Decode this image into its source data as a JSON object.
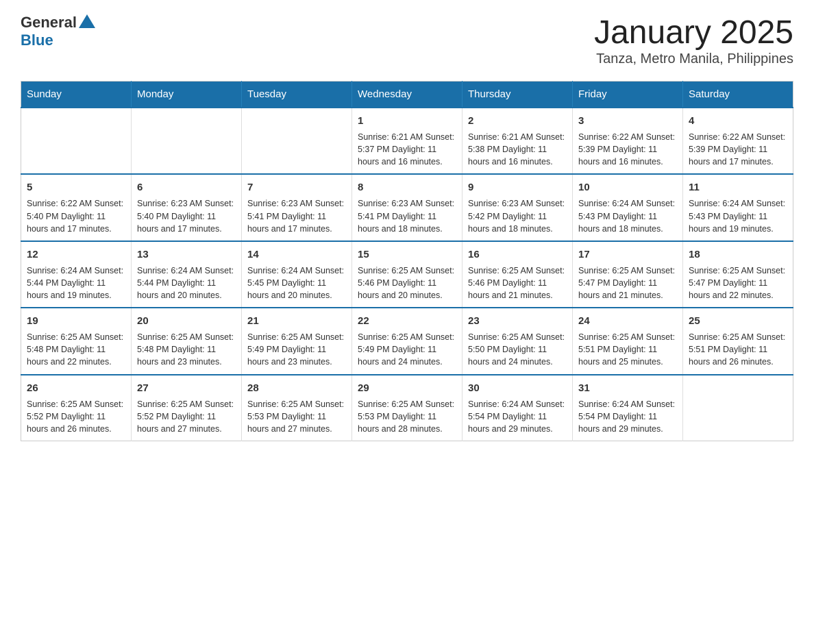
{
  "header": {
    "logo_general": "General",
    "logo_blue": "Blue",
    "title": "January 2025",
    "subtitle": "Tanza, Metro Manila, Philippines"
  },
  "weekdays": [
    "Sunday",
    "Monday",
    "Tuesday",
    "Wednesday",
    "Thursday",
    "Friday",
    "Saturday"
  ],
  "weeks": [
    [
      {
        "day": "",
        "info": ""
      },
      {
        "day": "",
        "info": ""
      },
      {
        "day": "",
        "info": ""
      },
      {
        "day": "1",
        "info": "Sunrise: 6:21 AM\nSunset: 5:37 PM\nDaylight: 11 hours and 16 minutes."
      },
      {
        "day": "2",
        "info": "Sunrise: 6:21 AM\nSunset: 5:38 PM\nDaylight: 11 hours and 16 minutes."
      },
      {
        "day": "3",
        "info": "Sunrise: 6:22 AM\nSunset: 5:39 PM\nDaylight: 11 hours and 16 minutes."
      },
      {
        "day": "4",
        "info": "Sunrise: 6:22 AM\nSunset: 5:39 PM\nDaylight: 11 hours and 17 minutes."
      }
    ],
    [
      {
        "day": "5",
        "info": "Sunrise: 6:22 AM\nSunset: 5:40 PM\nDaylight: 11 hours and 17 minutes."
      },
      {
        "day": "6",
        "info": "Sunrise: 6:23 AM\nSunset: 5:40 PM\nDaylight: 11 hours and 17 minutes."
      },
      {
        "day": "7",
        "info": "Sunrise: 6:23 AM\nSunset: 5:41 PM\nDaylight: 11 hours and 17 minutes."
      },
      {
        "day": "8",
        "info": "Sunrise: 6:23 AM\nSunset: 5:41 PM\nDaylight: 11 hours and 18 minutes."
      },
      {
        "day": "9",
        "info": "Sunrise: 6:23 AM\nSunset: 5:42 PM\nDaylight: 11 hours and 18 minutes."
      },
      {
        "day": "10",
        "info": "Sunrise: 6:24 AM\nSunset: 5:43 PM\nDaylight: 11 hours and 18 minutes."
      },
      {
        "day": "11",
        "info": "Sunrise: 6:24 AM\nSunset: 5:43 PM\nDaylight: 11 hours and 19 minutes."
      }
    ],
    [
      {
        "day": "12",
        "info": "Sunrise: 6:24 AM\nSunset: 5:44 PM\nDaylight: 11 hours and 19 minutes."
      },
      {
        "day": "13",
        "info": "Sunrise: 6:24 AM\nSunset: 5:44 PM\nDaylight: 11 hours and 20 minutes."
      },
      {
        "day": "14",
        "info": "Sunrise: 6:24 AM\nSunset: 5:45 PM\nDaylight: 11 hours and 20 minutes."
      },
      {
        "day": "15",
        "info": "Sunrise: 6:25 AM\nSunset: 5:46 PM\nDaylight: 11 hours and 20 minutes."
      },
      {
        "day": "16",
        "info": "Sunrise: 6:25 AM\nSunset: 5:46 PM\nDaylight: 11 hours and 21 minutes."
      },
      {
        "day": "17",
        "info": "Sunrise: 6:25 AM\nSunset: 5:47 PM\nDaylight: 11 hours and 21 minutes."
      },
      {
        "day": "18",
        "info": "Sunrise: 6:25 AM\nSunset: 5:47 PM\nDaylight: 11 hours and 22 minutes."
      }
    ],
    [
      {
        "day": "19",
        "info": "Sunrise: 6:25 AM\nSunset: 5:48 PM\nDaylight: 11 hours and 22 minutes."
      },
      {
        "day": "20",
        "info": "Sunrise: 6:25 AM\nSunset: 5:48 PM\nDaylight: 11 hours and 23 minutes."
      },
      {
        "day": "21",
        "info": "Sunrise: 6:25 AM\nSunset: 5:49 PM\nDaylight: 11 hours and 23 minutes."
      },
      {
        "day": "22",
        "info": "Sunrise: 6:25 AM\nSunset: 5:49 PM\nDaylight: 11 hours and 24 minutes."
      },
      {
        "day": "23",
        "info": "Sunrise: 6:25 AM\nSunset: 5:50 PM\nDaylight: 11 hours and 24 minutes."
      },
      {
        "day": "24",
        "info": "Sunrise: 6:25 AM\nSunset: 5:51 PM\nDaylight: 11 hours and 25 minutes."
      },
      {
        "day": "25",
        "info": "Sunrise: 6:25 AM\nSunset: 5:51 PM\nDaylight: 11 hours and 26 minutes."
      }
    ],
    [
      {
        "day": "26",
        "info": "Sunrise: 6:25 AM\nSunset: 5:52 PM\nDaylight: 11 hours and 26 minutes."
      },
      {
        "day": "27",
        "info": "Sunrise: 6:25 AM\nSunset: 5:52 PM\nDaylight: 11 hours and 27 minutes."
      },
      {
        "day": "28",
        "info": "Sunrise: 6:25 AM\nSunset: 5:53 PM\nDaylight: 11 hours and 27 minutes."
      },
      {
        "day": "29",
        "info": "Sunrise: 6:25 AM\nSunset: 5:53 PM\nDaylight: 11 hours and 28 minutes."
      },
      {
        "day": "30",
        "info": "Sunrise: 6:24 AM\nSunset: 5:54 PM\nDaylight: 11 hours and 29 minutes."
      },
      {
        "day": "31",
        "info": "Sunrise: 6:24 AM\nSunset: 5:54 PM\nDaylight: 11 hours and 29 minutes."
      },
      {
        "day": "",
        "info": ""
      }
    ]
  ]
}
